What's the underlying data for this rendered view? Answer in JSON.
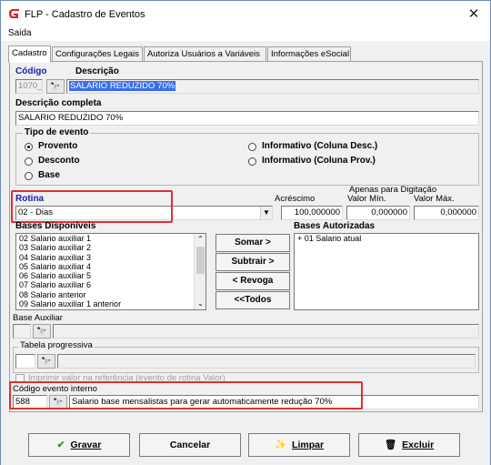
{
  "window": {
    "title": "FLP - Cadastro de Eventos"
  },
  "menu": {
    "items": [
      "Saida"
    ]
  },
  "tabs": [
    "Cadastro",
    "Configurações Legais",
    "Autoriza Usuários a Variáveis",
    "Informações eSocial"
  ],
  "cadastro": {
    "codigo_label": "Código",
    "codigo_value": "1070_",
    "descricao_label": "Descrição",
    "descricao_value": "SALARIO REDUZIDO 70%",
    "descricao_completa_label": "Descrição completa",
    "descricao_completa_value": "SALARIO REDUZIDO 70%"
  },
  "tipo_evento": {
    "label": "Tipo de evento",
    "options": [
      {
        "label": "Provento",
        "selected": true
      },
      {
        "label": "Desconto",
        "selected": false
      },
      {
        "label": "Base",
        "selected": false
      },
      {
        "label": "Informativo (Coluna Desc.)",
        "selected": false
      },
      {
        "label": "Informativo (Coluna Prov.)",
        "selected": false
      }
    ]
  },
  "rotina": {
    "label": "Rotina",
    "value": "02 - Dias"
  },
  "digitacao": {
    "header": "Apenas para Digitação",
    "acrescimo_label": "Acréscimo",
    "acrescimo_value": "100,000000",
    "valor_min_label": "Valor Mín.",
    "valor_min_value": "0,000000",
    "valor_max_label": "Valor Máx.",
    "valor_max_value": "0,000000"
  },
  "bases_disponiveis": {
    "label": "Bases Disponíveis",
    "items": [
      "02 Salario auxiliar 1",
      "03 Salario auxiliar 2",
      "04 Salario auxiliar 3",
      "05 Salario auxiliar 4",
      "06 Salario auxiliar 5",
      "07 Salario auxiliar 6",
      "08 Salario anterior",
      "09 Salario auxiliar 1 anterior"
    ]
  },
  "bases_autorizadas": {
    "label": "Bases Autorizadas",
    "items": [
      "+ 01 Salario atual"
    ]
  },
  "transfer_buttons": {
    "somar": "Somar >",
    "subtrair": "Subtrair >",
    "revoga": "< Revoga",
    "todos": "<<Todos"
  },
  "base_auxiliar": {
    "label": "Base Auxiliar"
  },
  "tabela_progressiva": {
    "label": "Tabela progressiva"
  },
  "imprimir": {
    "label": "Imprimir valor na referência (evento de rotina Valor)"
  },
  "codigo_interno": {
    "label": "Código evento interno",
    "code": "588",
    "description": "Salario base mensalistas para gerar automaticamente redução 70%"
  },
  "actions": {
    "gravar": "Gravar",
    "cancelar": "Cancelar",
    "limpar": "Limpar",
    "excluir": "Excluir"
  },
  "colors": {
    "highlight": "#e03030",
    "label_blue": "#1a1aa8",
    "selection": "#3a6ee8"
  },
  "icons": [
    "app-logo-icon",
    "close-icon",
    "binoculars-icon",
    "check-icon",
    "wand-icon",
    "trash-icon"
  ]
}
